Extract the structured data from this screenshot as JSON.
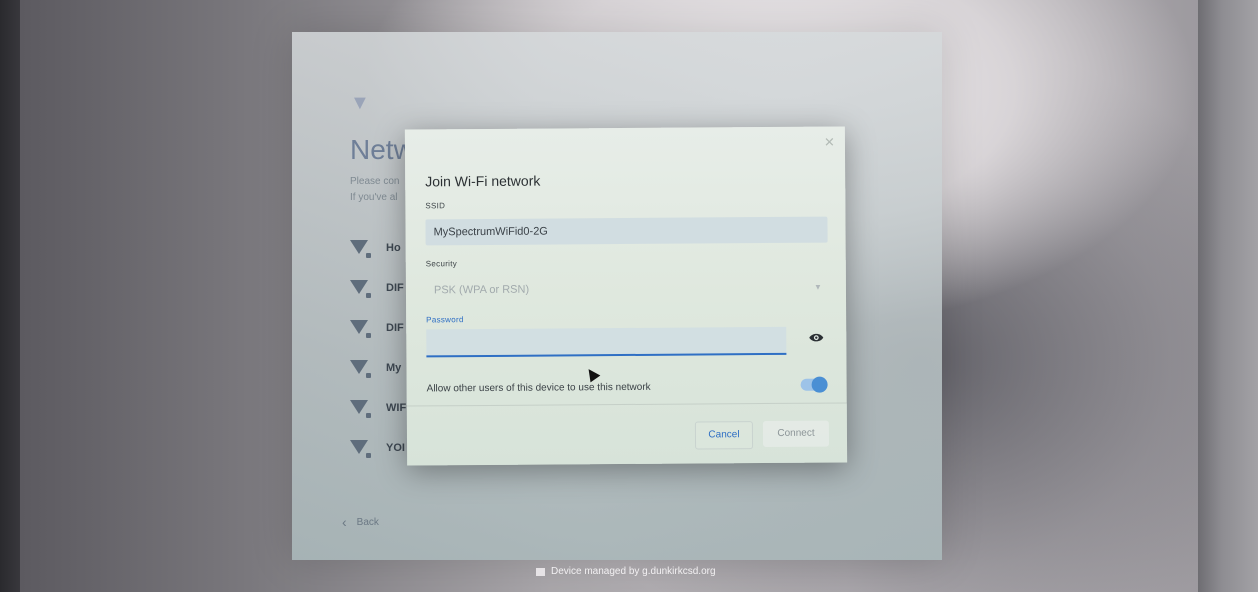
{
  "oobe": {
    "title_partial": "Netw",
    "subtitle_line1": "Please con",
    "subtitle_line2": "If you've al",
    "networks": [
      {
        "label": "Ho",
        "icon": "wifi-locked-icon"
      },
      {
        "label": "DIF",
        "icon": "wifi-locked-icon"
      },
      {
        "label": "DIF",
        "icon": "wifi-locked-icon"
      },
      {
        "label": "My",
        "icon": "wifi-locked-icon"
      },
      {
        "label": "WIF",
        "icon": "wifi-locked-icon"
      },
      {
        "label": "YOI",
        "icon": "wifi-locked-icon"
      }
    ],
    "back_label": "Back"
  },
  "dialog": {
    "title": "Join Wi-Fi network",
    "ssid_label": "SSID",
    "ssid_value": "MySpectrumWiFid0-2G",
    "security_label": "Security",
    "security_value": "PSK (WPA or RSN)",
    "password_label": "Password",
    "password_value": "",
    "allow_text": "Allow other users of this device to use this network",
    "allow_enabled": true,
    "cancel_label": "Cancel",
    "connect_label": "Connect"
  },
  "footer": {
    "managed_text": "Device managed by g.dunkirkcsd.org"
  },
  "colors": {
    "accent": "#2f6fc4",
    "toggle_on": "#4a8fd4"
  }
}
